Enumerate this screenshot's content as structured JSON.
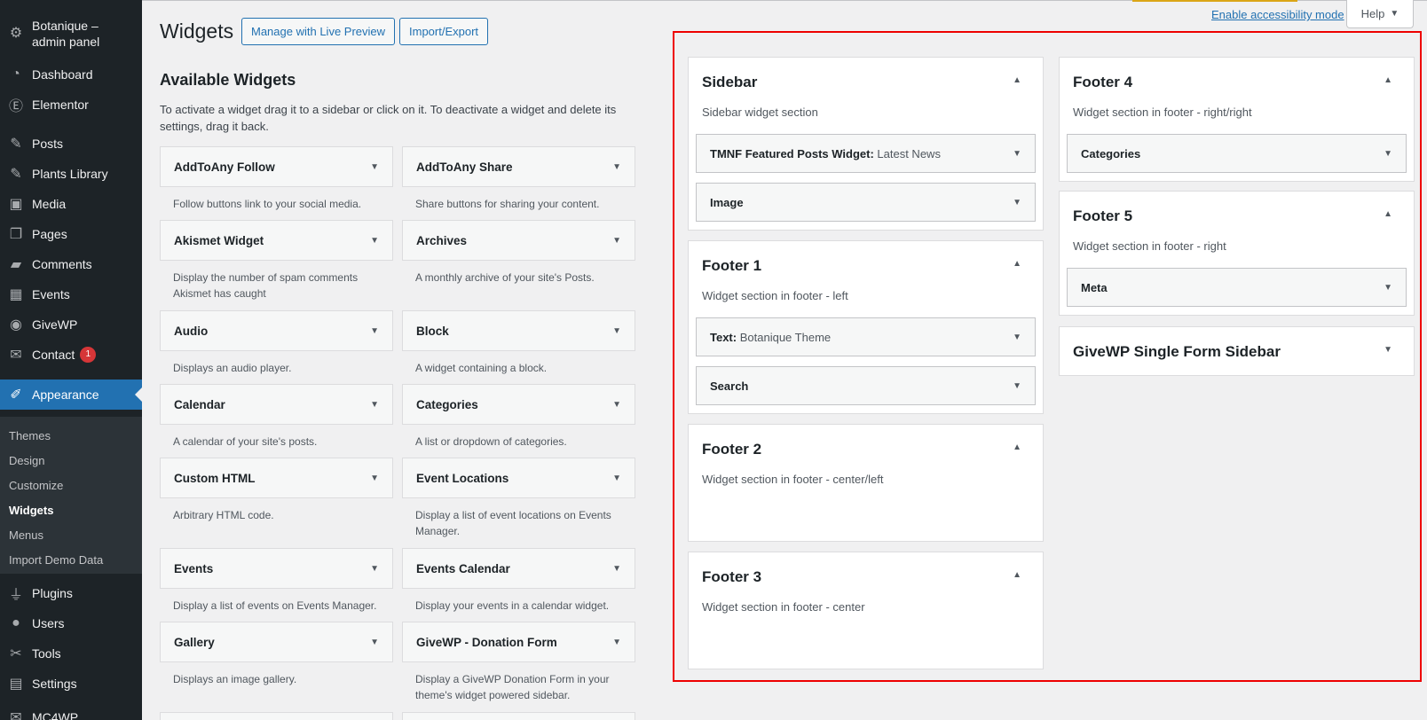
{
  "admin_menu": {
    "site_title": "Botanique – admin panel",
    "items": [
      {
        "label": "Dashboard",
        "icon": "gauge-icon"
      },
      {
        "label": "Elementor",
        "icon": "elementor-icon"
      },
      {
        "label": "Posts",
        "icon": "pin-icon"
      },
      {
        "label": "Plants Library",
        "icon": "pin-icon"
      },
      {
        "label": "Media",
        "icon": "media-icon"
      },
      {
        "label": "Pages",
        "icon": "pages-icon"
      },
      {
        "label": "Comments",
        "icon": "comment-icon"
      },
      {
        "label": "Events",
        "icon": "calendar-icon"
      },
      {
        "label": "GiveWP",
        "icon": "givewp-icon"
      },
      {
        "label": "Contact",
        "icon": "mail-icon",
        "badge": "1"
      },
      {
        "label": "Appearance",
        "icon": "brush-icon"
      },
      {
        "label": "Plugins",
        "icon": "plug-icon"
      },
      {
        "label": "Users",
        "icon": "user-icon"
      },
      {
        "label": "Tools",
        "icon": "wrench-icon"
      },
      {
        "label": "Settings",
        "icon": "sliders-icon"
      },
      {
        "label": "MC4WP",
        "icon": "mc4wp-icon"
      }
    ],
    "submenu": [
      "Themes",
      "Design",
      "Customize",
      "Widgets",
      "Menus",
      "Import Demo Data"
    ],
    "current_item": "Appearance",
    "current_sub": "Widgets"
  },
  "header": {
    "title": "Widgets",
    "manage_live": "Manage with Live Preview",
    "import_export": "Import/Export",
    "accessibility_link": "Enable accessibility mode",
    "help": "Help"
  },
  "available": {
    "title": "Available Widgets",
    "description": "To activate a widget drag it to a sidebar or click on it. To deactivate a widget and delete its settings, drag it back.",
    "widgets": [
      {
        "title": "AddToAny Follow",
        "desc": "Follow buttons link to your social media."
      },
      {
        "title": "AddToAny Share",
        "desc": "Share buttons for sharing your content."
      },
      {
        "title": "Akismet Widget",
        "desc": "Display the number of spam comments Akismet has caught"
      },
      {
        "title": "Archives",
        "desc": "A monthly archive of your site's Posts."
      },
      {
        "title": "Audio",
        "desc": "Displays an audio player."
      },
      {
        "title": "Block",
        "desc": "A widget containing a block."
      },
      {
        "title": "Calendar",
        "desc": "A calendar of your site's posts."
      },
      {
        "title": "Categories",
        "desc": "A list or dropdown of categories."
      },
      {
        "title": "Custom HTML",
        "desc": "Arbitrary HTML code."
      },
      {
        "title": "Event Locations",
        "desc": "Display a list of event locations on Events Manager."
      },
      {
        "title": "Events",
        "desc": "Display a list of events on Events Manager."
      },
      {
        "title": "Events Calendar",
        "desc": "Display your events in a calendar widget."
      },
      {
        "title": "Gallery",
        "desc": "Displays an image gallery."
      },
      {
        "title": "GiveWP - Donation Form",
        "desc": "Display a GiveWP Donation Form in your theme's widget powered sidebar."
      }
    ]
  },
  "sidebars": {
    "sidebar": {
      "title": "Sidebar",
      "desc": "Sidebar widget section",
      "widgets": [
        {
          "title": "TMNF Featured Posts Widget:",
          "in_title": "Latest News"
        },
        {
          "title": "Image",
          "in_title": ""
        }
      ]
    },
    "footer1": {
      "title": "Footer 1",
      "desc": "Widget section in footer - left",
      "widgets": [
        {
          "title": "Text:",
          "in_title": "Botanique Theme"
        },
        {
          "title": "Search",
          "in_title": ""
        }
      ]
    },
    "footer2": {
      "title": "Footer 2",
      "desc": "Widget section in footer - center/left"
    },
    "footer3": {
      "title": "Footer 3",
      "desc": "Widget section in footer - center"
    },
    "footer4": {
      "title": "Footer 4",
      "desc": "Widget section in footer - right/right",
      "widgets": [
        {
          "title": "Categories",
          "in_title": ""
        }
      ]
    },
    "footer5": {
      "title": "Footer 5",
      "desc": "Widget section in footer - right",
      "widgets": [
        {
          "title": "Meta",
          "in_title": ""
        }
      ]
    },
    "givewp": {
      "title": "GiveWP Single Form Sidebar"
    }
  },
  "colors": {
    "accent": "#2271b1",
    "menu_bg": "#1d2327",
    "highlight_border": "#e00000",
    "badge": "#d63638"
  }
}
